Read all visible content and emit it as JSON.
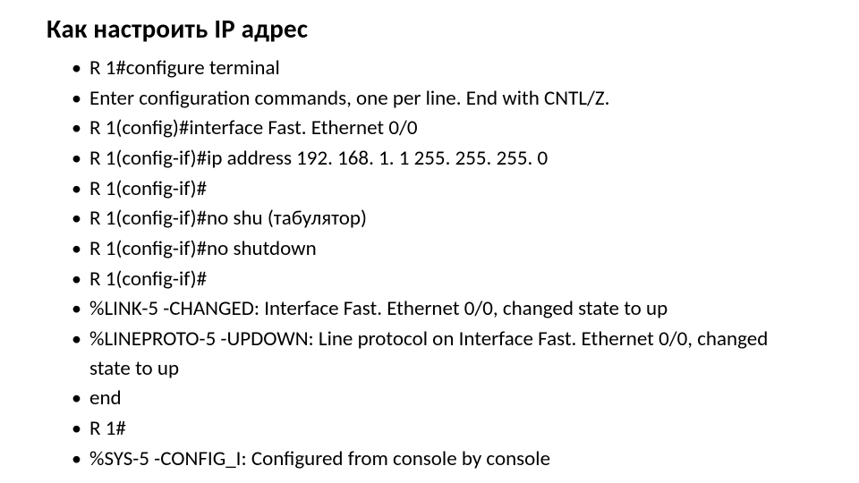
{
  "title": "Как настроить IP адрес",
  "items": [
    "R 1#configure terminal",
    "Enter configuration commands, one per line. End with CNTL/Z.",
    "R 1(config)#interface Fast. Ethernet 0/0",
    "R 1(config-if)#ip address 192. 168. 1. 1 255. 255. 255. 0",
    "R 1(config-if)#",
    "R 1(config-if)#no shu (табулятор)",
    "R 1(config-if)#no shutdown",
    "R 1(config-if)#",
    "%LINK-5 -CHANGED: Interface Fast. Ethernet 0/0, changed state to up",
    "%LINEPROTO-5 -UPDOWN: Line protocol on Interface Fast. Ethernet 0/0, changed state to up",
    "end",
    "R 1#",
    "%SYS-5 -CONFIG_I: Configured from console by console"
  ]
}
